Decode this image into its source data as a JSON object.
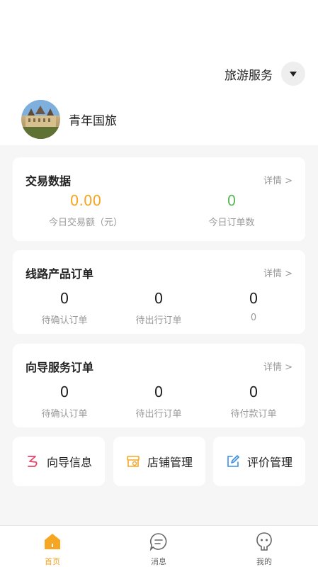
{
  "header": {
    "service_label": "旅游服务",
    "org_name": "青年国旅"
  },
  "trade_card": {
    "title": "交易数据",
    "link": "详情 >",
    "stats": [
      {
        "value": "0.00",
        "label": "今日交易额（元）"
      },
      {
        "value": "0",
        "label": "今日订单数"
      }
    ]
  },
  "route_card": {
    "title": "线路产品订单",
    "link": "详情 >",
    "stats": [
      {
        "value": "0",
        "label": "待确认订单"
      },
      {
        "value": "0",
        "label": "待出行订单"
      },
      {
        "value": "0",
        "label": "0"
      }
    ]
  },
  "guide_card": {
    "title": "向导服务订单",
    "link": "详情 >",
    "stats": [
      {
        "value": "0",
        "label": "待确认订单"
      },
      {
        "value": "0",
        "label": "待出行订单"
      },
      {
        "value": "0",
        "label": "待付款订单"
      }
    ]
  },
  "quick_actions": [
    {
      "label": "向导信息",
      "icon": "guide-icon"
    },
    {
      "label": "店铺管理",
      "icon": "store-icon"
    },
    {
      "label": "评价管理",
      "icon": "edit-icon"
    }
  ],
  "tabbar": [
    {
      "label": "首页",
      "icon": "home-icon",
      "active": true
    },
    {
      "label": "消息",
      "icon": "message-icon",
      "active": false
    },
    {
      "label": "我的",
      "icon": "profile-icon",
      "active": false
    }
  ],
  "colors": {
    "accent": "#f5a623",
    "green": "#5cb85c",
    "background": "#f6f6f6"
  }
}
